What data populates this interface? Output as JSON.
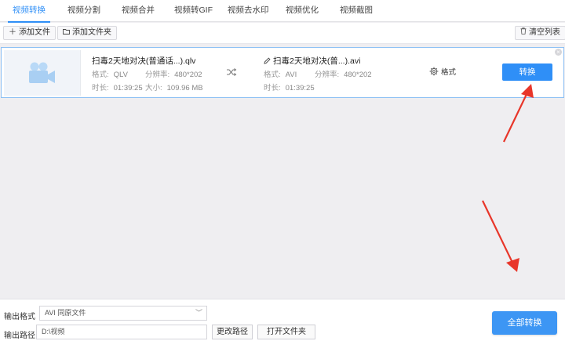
{
  "tabs": [
    {
      "label": "视频转换",
      "active": true
    },
    {
      "label": "视频分割"
    },
    {
      "label": "视频合并"
    },
    {
      "label": "视频转GIF"
    },
    {
      "label": "视频去水印"
    },
    {
      "label": "视频优化"
    },
    {
      "label": "视频截图"
    }
  ],
  "toolbar": {
    "add_file": "添加文件",
    "add_folder": "添加文件夹",
    "clear_list": "清空列表"
  },
  "item": {
    "source": {
      "name": "扫毒2天地对决(普通话...).qlv",
      "format_label": "格式:",
      "format": "QLV",
      "resolution_label": "分辨率:",
      "resolution": "480*202",
      "duration_label": "时长:",
      "duration": "01:39:25",
      "size_label": "大小:",
      "size": "109.96 MB"
    },
    "output": {
      "name": "扫毒2天地对决(普...).avi",
      "format_label": "格式:",
      "format": "AVI",
      "resolution_label": "分辨率:",
      "resolution": "480*202",
      "duration_label": "时长:",
      "duration": "01:39:25"
    },
    "format_settings": "格式",
    "convert_label": "转换"
  },
  "bottom": {
    "output_format_label": "输出格式",
    "output_format_value": "AVI  同原文件",
    "output_path_label": "输出路径",
    "output_path_value": "D:\\视频",
    "change_path": "更改路径",
    "open_folder": "打开文件夹",
    "convert_all": "全部转换"
  },
  "colors": {
    "accent": "#2f8ff7",
    "annotation_arrow": "#e8362a"
  }
}
